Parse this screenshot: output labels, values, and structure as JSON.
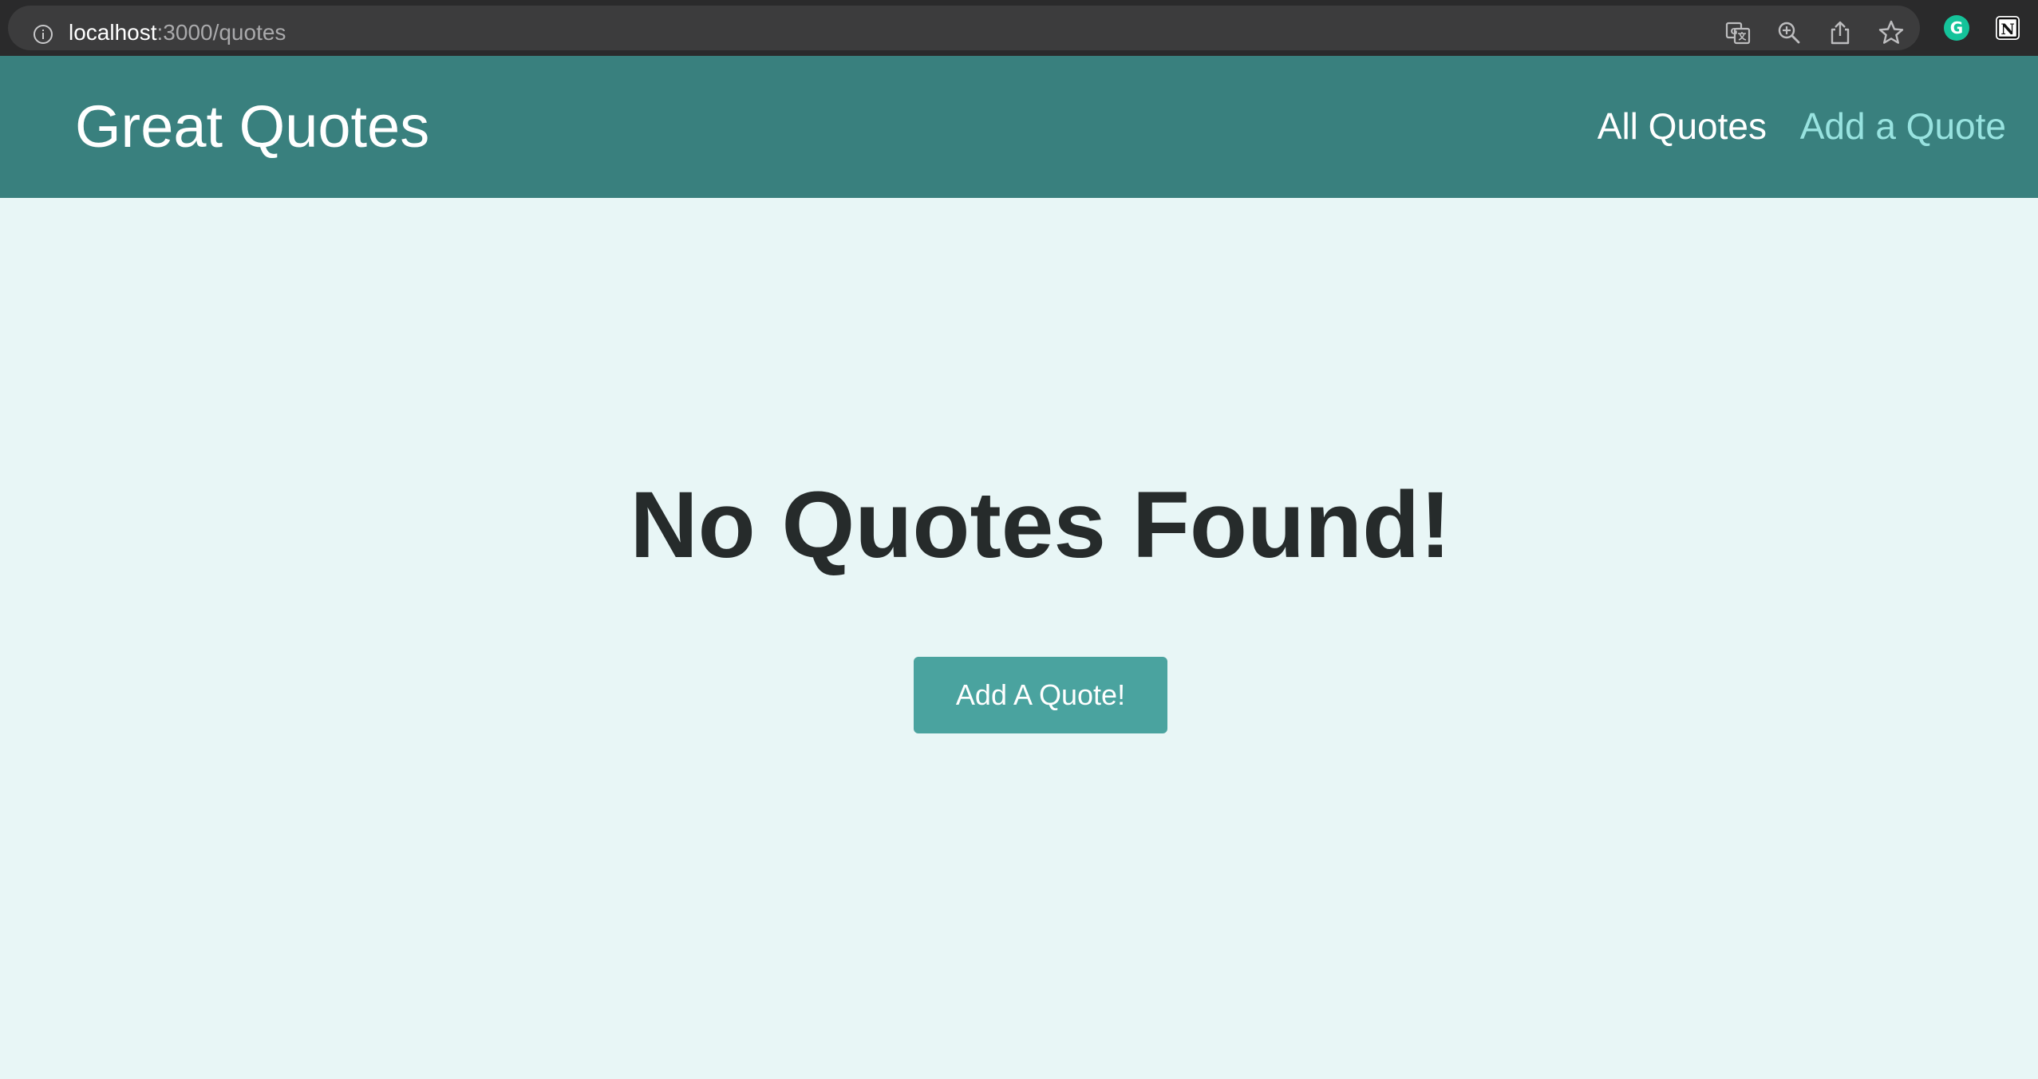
{
  "browser": {
    "url_host": "localhost",
    "url_path": ":3000/quotes",
    "icons": [
      "site-info-icon",
      "translate-icon",
      "zoom-icon",
      "share-icon",
      "bookmark-star-icon",
      "grammarly-extension-icon",
      "notion-extension-icon"
    ],
    "grammarly_letter": "G",
    "notion_letter": "N"
  },
  "header": {
    "logo": "Great Quotes",
    "nav": {
      "all_quotes": "All Quotes",
      "add_quote": "Add a Quote"
    }
  },
  "main": {
    "empty_message": "No Quotes Found!",
    "add_button_label": "Add A Quote!"
  },
  "colors": {
    "header_bg": "#39807e",
    "page_bg": "#e8f6f6",
    "button_bg": "#4aa39f",
    "active_nav": "#98e3e0",
    "heading_text": "#262b2b"
  }
}
